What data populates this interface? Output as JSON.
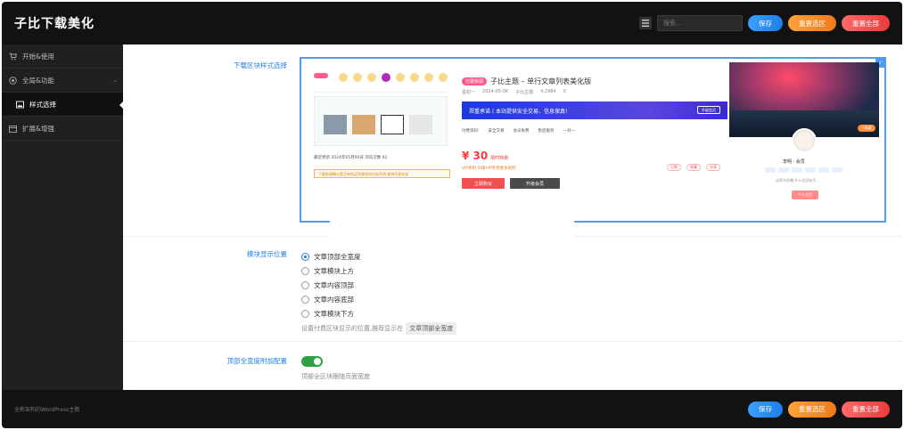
{
  "app": {
    "title": "子比下载美化"
  },
  "topbar": {
    "search_placeholder": "搜索...",
    "save_label": "保存",
    "reset_section_label": "重置选区",
    "reset_all_label": "重置全部"
  },
  "sidebar": {
    "items": [
      {
        "label": "开始&使用",
        "icon": "cart-icon"
      },
      {
        "label": "全局&功能",
        "icon": "globe-icon",
        "chevron": "⌄"
      },
      {
        "label": "样式选择",
        "icon": "image-icon",
        "active": true
      },
      {
        "label": "扩展&增强",
        "icon": "calendar-icon"
      }
    ]
  },
  "main": {
    "download_style": {
      "label": "下载区块样式选择",
      "preview": {
        "title_tag": "付费资源",
        "title": "子比主题 – 单行文章列表美化版",
        "meta": [
          "墨初一",
          "2024-05-06",
          "子比主题",
          "4.2984",
          "0"
        ],
        "banner_text": "郑重承诺丨本站提供安全交易、信息保真!",
        "banner_button": "升级会员",
        "list_items": [
          "付费资料:",
          "安全交易",
          "会员免费",
          "售后服务",
          "一对一"
        ],
        "price": "¥ 30",
        "price_note": "限时特惠",
        "vip_text": "VIP折扣  升级VIP享受更多福利",
        "tags": [
          "已购",
          "收藏",
          "分享"
        ],
        "buy_button": "立即购买",
        "member_button": "升级会员",
        "card_label": "已收藏",
        "username": "李明 · 会员",
        "desc": "这家伙很懒,什么也没有写...",
        "card_button": "个人主页",
        "left_meta": "最近更新  2024年05月06日      浏览次数  62",
        "left_warning": "下载前请确认是否有购买同意权利对本声明,保持同意协议"
      }
    },
    "position": {
      "label": "模块显示位置",
      "options": [
        "文章顶部全宽度",
        "文章模块上方",
        "文章内容顶部",
        "文章内容底部",
        "文章模块下方"
      ],
      "selected_index": 0,
      "help_prefix": "设置付费区块显示的位置,推荐显示在",
      "help_code": "文章顶部全宽度"
    },
    "fullwidth": {
      "label": "顶部全宽度附加配置",
      "enabled": true,
      "help": "顶部全区块跟随页面宽度"
    }
  },
  "footer": {
    "copyright": "全新架构的WordPress主题",
    "save_label": "保存",
    "reset_section_label": "重置选区",
    "reset_all_label": "重置全部"
  },
  "colors": {
    "accent": "#1e7ee6",
    "save": "#2f8cf0",
    "reset_section": "#f58a2a",
    "reset_all": "#f04545",
    "toggle_on": "#2ea043"
  }
}
